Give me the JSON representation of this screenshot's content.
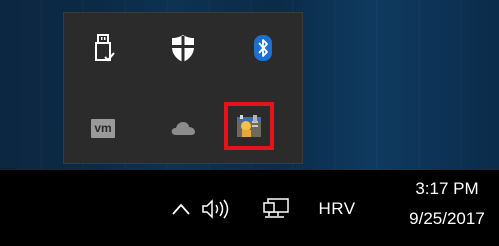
{
  "flyout": {
    "icons": [
      {
        "name": "usb-safely-remove-icon"
      },
      {
        "name": "windows-defender-shield-icon"
      },
      {
        "name": "bluetooth-icon"
      },
      {
        "name": "vmware-icon",
        "label": "vm"
      },
      {
        "name": "onedrive-cloud-icon"
      },
      {
        "name": "highlighted-app-icon"
      }
    ],
    "highlight_color": "#e5141c"
  },
  "taskbar": {
    "chevron": "^",
    "language": "HRV",
    "time": "3:17 PM",
    "date": "9/25/2017"
  }
}
